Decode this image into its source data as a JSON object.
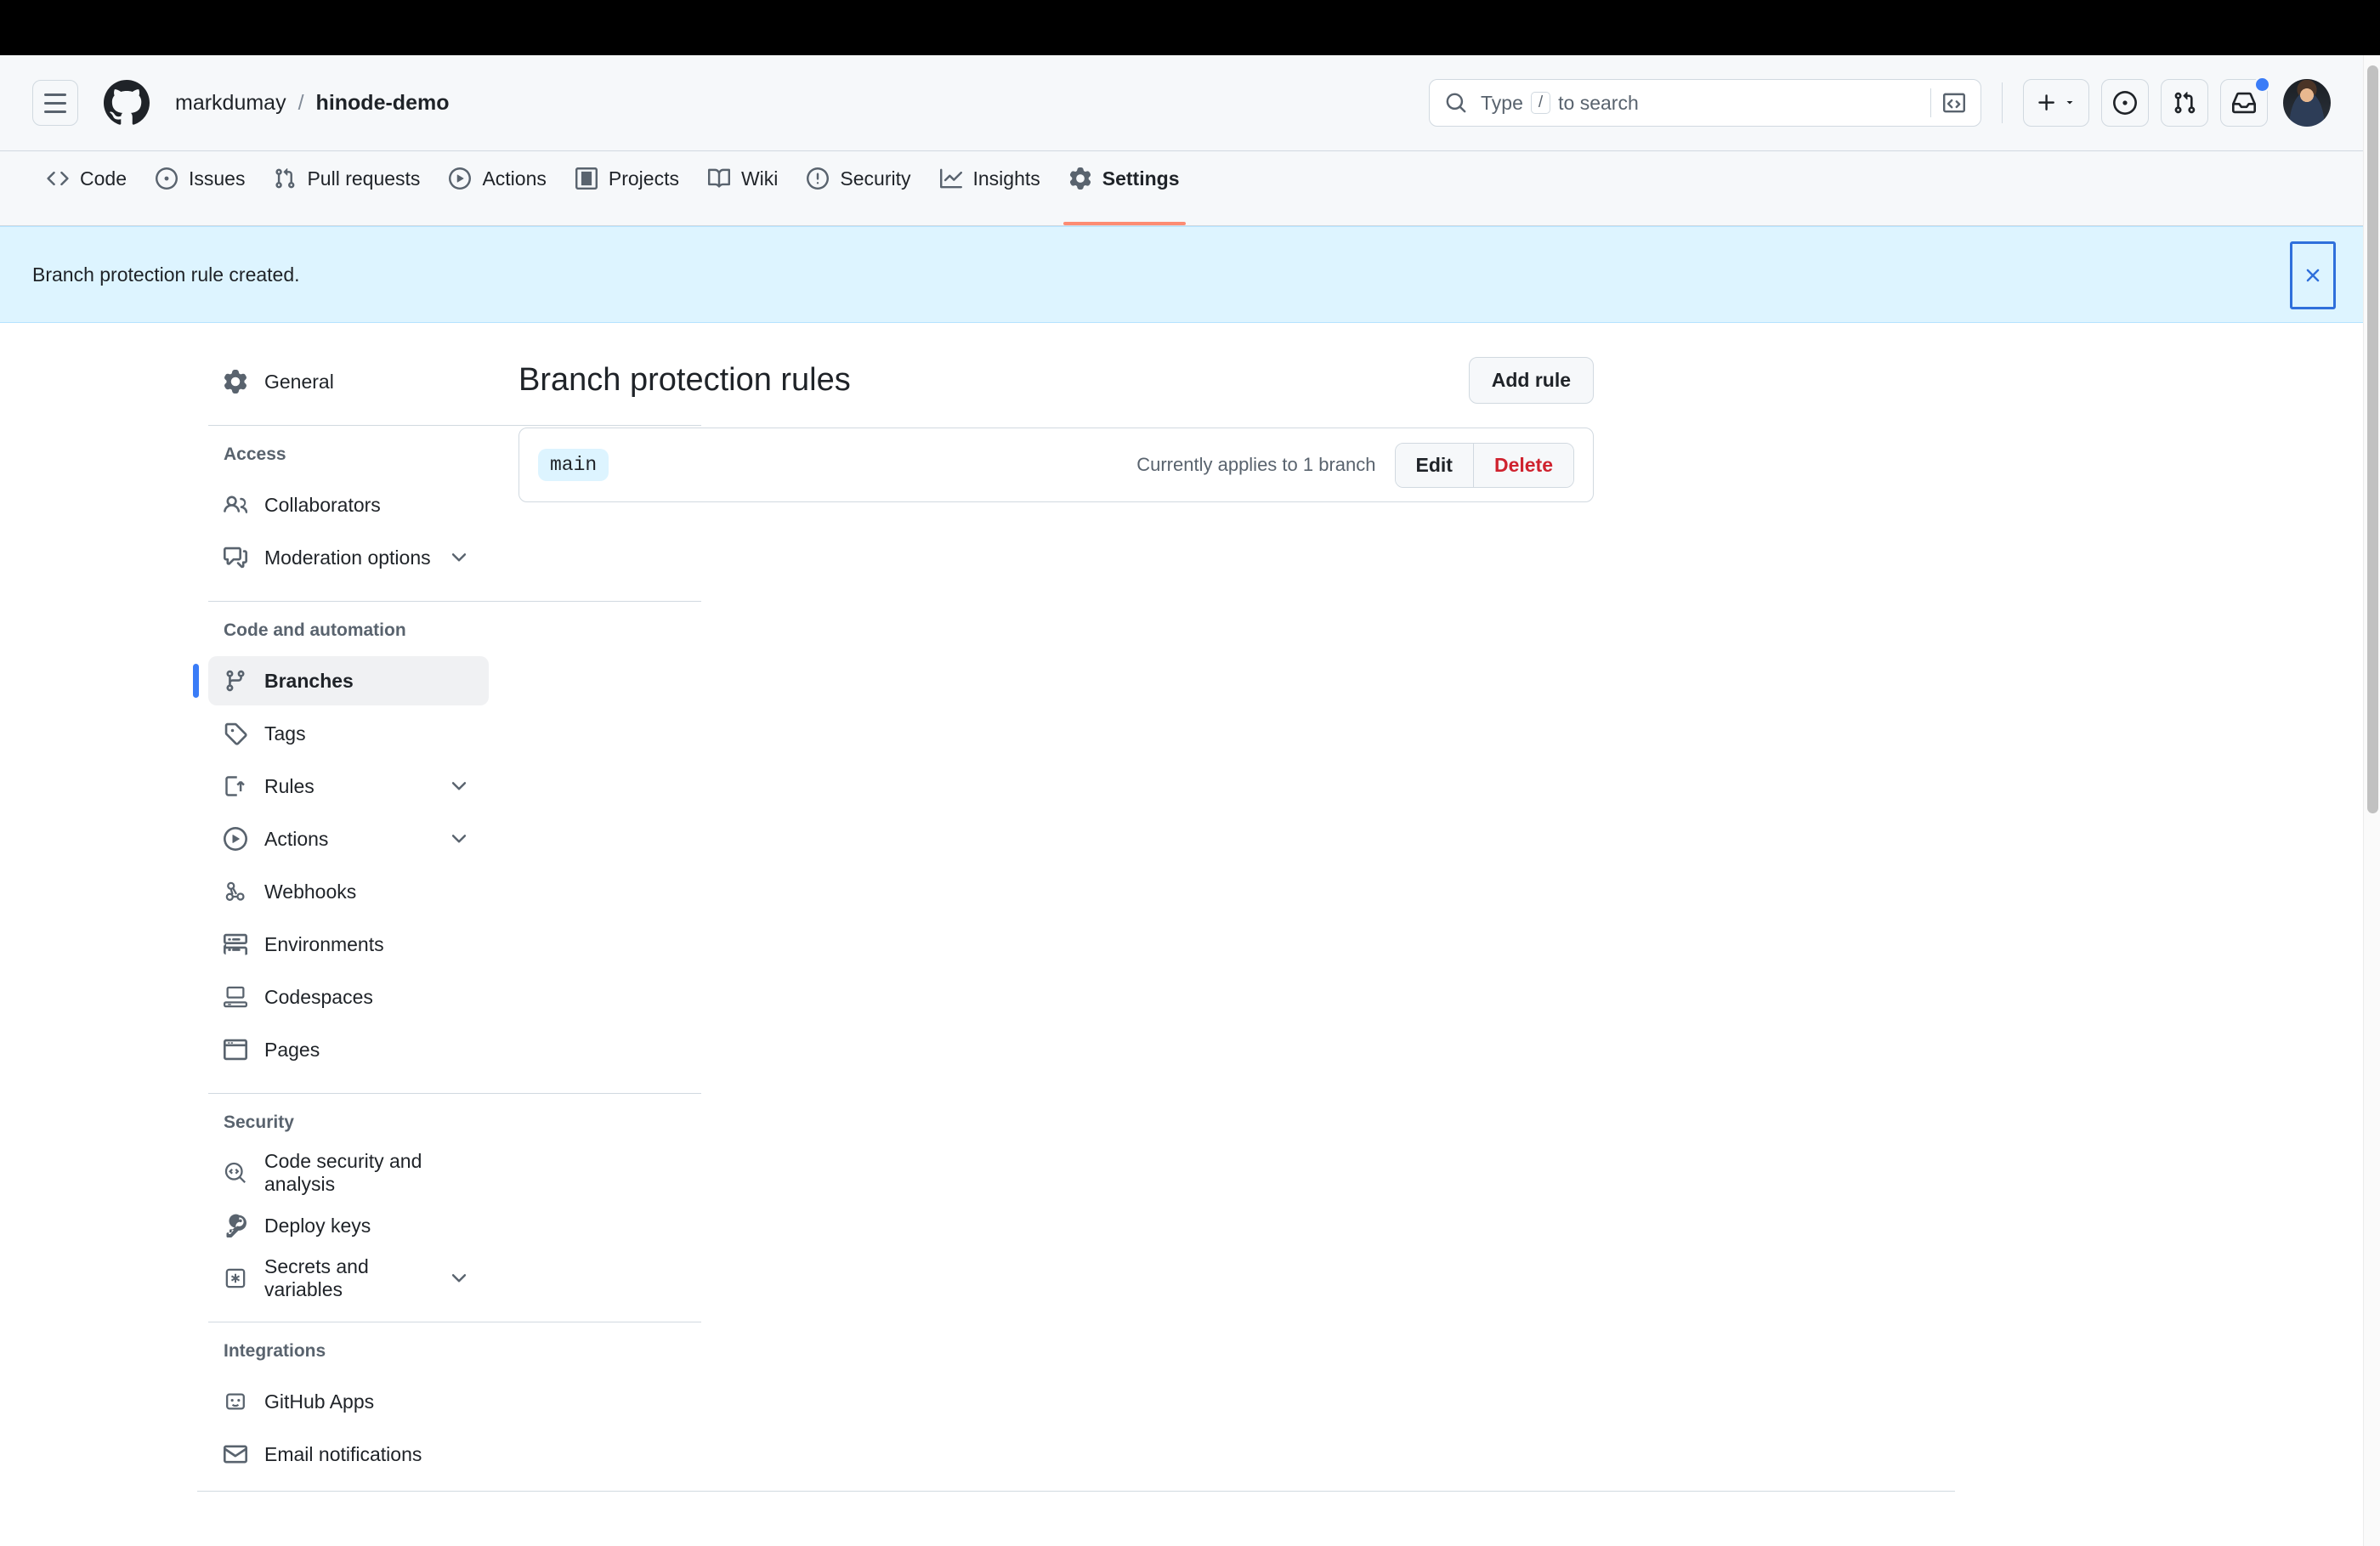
{
  "header": {
    "menu_icon": "hamburger-icon",
    "logo_icon": "github-logo-icon",
    "owner": "markdumay",
    "separator": "/",
    "repo": "hinode-demo",
    "search": {
      "icon": "search-icon",
      "placeholder_prefix": "Type",
      "slash_key": "/",
      "placeholder_suffix": "to search",
      "terminal_icon": "terminal-icon"
    },
    "actions": [
      {
        "name": "create-new-button",
        "icon": "plus-icon",
        "has_caret": true
      },
      {
        "name": "issues-button",
        "icon": "issue-opened-icon"
      },
      {
        "name": "pull-requests-button",
        "icon": "git-pull-request-icon"
      },
      {
        "name": "notifications-button",
        "icon": "inbox-icon",
        "has_dot": true
      },
      {
        "name": "user-avatar",
        "icon": "avatar"
      }
    ]
  },
  "repo_nav": {
    "tabs": [
      {
        "label": "Code",
        "icon": "code-icon",
        "active": false
      },
      {
        "label": "Issues",
        "icon": "issue-opened-icon",
        "active": false
      },
      {
        "label": "Pull requests",
        "icon": "git-pull-request-icon",
        "active": false
      },
      {
        "label": "Actions",
        "icon": "play-icon",
        "active": false
      },
      {
        "label": "Projects",
        "icon": "table-icon",
        "active": false
      },
      {
        "label": "Wiki",
        "icon": "book-icon",
        "active": false
      },
      {
        "label": "Security",
        "icon": "shield-icon",
        "active": false
      },
      {
        "label": "Insights",
        "icon": "graph-icon",
        "active": false
      },
      {
        "label": "Settings",
        "icon": "gear-icon",
        "active": true
      }
    ]
  },
  "flash": {
    "message": "Branch protection rule created.",
    "close_icon": "close-icon"
  },
  "sidebar": {
    "general": {
      "label": "General",
      "icon": "gear-icon"
    },
    "groups": [
      {
        "heading": "Access",
        "items": [
          {
            "label": "Collaborators",
            "icon": "people-icon",
            "expandable": false
          },
          {
            "label": "Moderation options",
            "icon": "comment-discussion-icon",
            "expandable": true
          }
        ]
      },
      {
        "heading": "Code and automation",
        "items": [
          {
            "label": "Branches",
            "icon": "git-branch-icon",
            "expandable": false,
            "active": true
          },
          {
            "label": "Tags",
            "icon": "tag-icon",
            "expandable": false
          },
          {
            "label": "Rules",
            "icon": "rules-icon",
            "expandable": true
          },
          {
            "label": "Actions",
            "icon": "play-icon",
            "expandable": true
          },
          {
            "label": "Webhooks",
            "icon": "webhook-icon",
            "expandable": false
          },
          {
            "label": "Environments",
            "icon": "server-icon",
            "expandable": false
          },
          {
            "label": "Codespaces",
            "icon": "codespaces-icon",
            "expandable": false
          },
          {
            "label": "Pages",
            "icon": "browser-icon",
            "expandable": false
          }
        ]
      },
      {
        "heading": "Security",
        "items": [
          {
            "label": "Code security and analysis",
            "icon": "codescan-icon",
            "expandable": false
          },
          {
            "label": "Deploy keys",
            "icon": "key-icon",
            "expandable": false
          },
          {
            "label": "Secrets and variables",
            "icon": "secret-icon",
            "expandable": true
          }
        ]
      },
      {
        "heading": "Integrations",
        "items": [
          {
            "label": "GitHub Apps",
            "icon": "apps-icon",
            "expandable": false
          },
          {
            "label": "Email notifications",
            "icon": "mail-icon",
            "expandable": false
          }
        ]
      }
    ]
  },
  "main": {
    "title": "Branch protection rules",
    "add_rule_label": "Add rule",
    "rules": [
      {
        "branch_pattern": "main",
        "applies_to": "Currently applies to 1 branch",
        "edit_label": "Edit",
        "delete_label": "Delete"
      }
    ]
  },
  "colors": {
    "accent_blue": "#3a7cf7",
    "active_tab_underline": "#fd8c73",
    "flash_bg": "#ddf4ff",
    "flash_border": "#b6e3ff",
    "danger_red": "#cf222e",
    "border": "#d1d9e0",
    "canvas_subtle": "#f6f8fa"
  }
}
